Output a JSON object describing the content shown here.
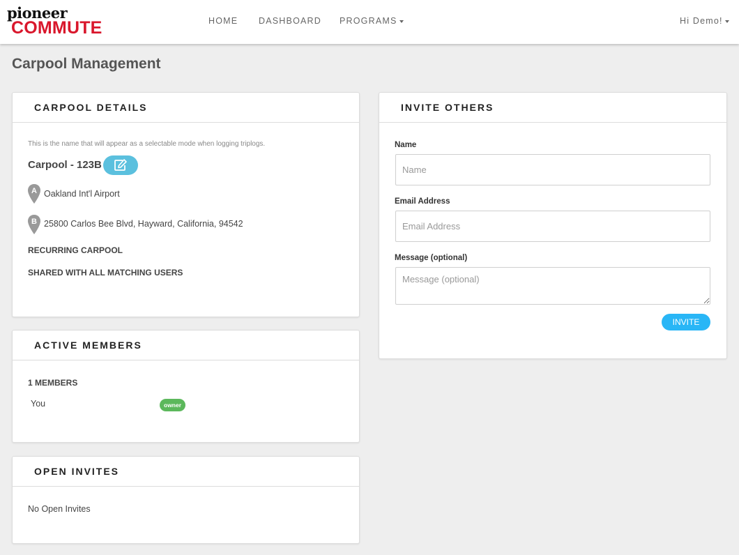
{
  "brand": {
    "line1": "pioneer",
    "line2": "COMMUTE",
    "color": "#d9172c"
  },
  "nav": {
    "home": "HOME",
    "dashboard": "DASHBOARD",
    "programs": "PROGRAMS",
    "user_menu": "Hi Demo!"
  },
  "page": {
    "title": "Carpool Management"
  },
  "carpool_details": {
    "heading": "CARPOOL DETAILS",
    "hint": "This is the name that will appear as a selectable mode when logging triplogs.",
    "name": "Carpool - 123B",
    "edit_icon": "edit-icon",
    "origin_marker": "A",
    "origin": "Oakland Int'l Airport",
    "destination_marker": "B",
    "destination": "25800 Carlos Bee Blvd, Hayward, California, 94542",
    "recurring": "RECURRING CARPOOL",
    "shared": "SHARED WITH ALL MATCHING USERS"
  },
  "active_members": {
    "heading": "ACTIVE MEMBERS",
    "count_label": "1 MEMBERS",
    "members": [
      {
        "name": "You",
        "role": "owner"
      }
    ]
  },
  "open_invites": {
    "heading": "OPEN INVITES",
    "empty_text": "No Open Invites"
  },
  "invite_others": {
    "heading": "INVITE OTHERS",
    "name_label": "Name",
    "name_placeholder": "Name",
    "email_label": "Email Address",
    "email_placeholder": "Email Address",
    "message_label": "Message (optional)",
    "message_placeholder": "Message (optional)",
    "submit_label": "INVITE"
  },
  "colors": {
    "accent": "#29b6f6",
    "edit_button": "#5bc0de",
    "owner_badge": "#5cb85c",
    "pin": "#999999"
  }
}
